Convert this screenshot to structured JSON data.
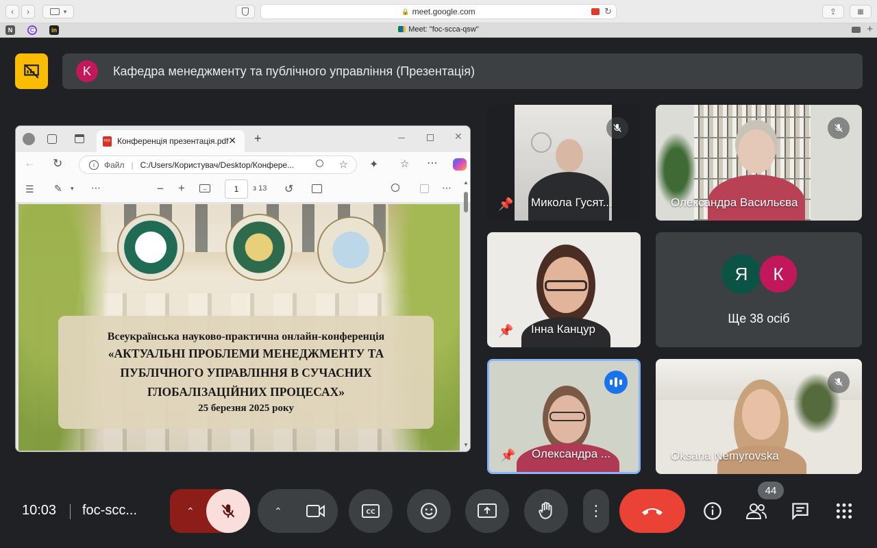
{
  "browser": {
    "url": "meet.google.com",
    "tab_title": "Meet: \"foc-scca-qsw\"",
    "favorites": [
      "N",
      "C",
      "in"
    ]
  },
  "header": {
    "avatar_letter": "K",
    "meeting_title": "Кафедра менеджменту та публічного управління (Презентація)"
  },
  "shared_screen": {
    "tab_title": "Конференція презентація.pdf",
    "address_label": "Файл",
    "address_path": "C:/Users/Користувач/Desktop/Конфере...",
    "page_current": "1",
    "page_total": "з 13",
    "slide": {
      "line1": "Всеукраїнська науково-практична онлайн-конференція",
      "line2": "«АКТУАЛЬНІ ПРОБЛЕМИ МЕНЕДЖМЕНТУ ТА",
      "line3": "ПУБЛІЧНОГО УПРАВЛІННЯ В СУЧАСНИХ",
      "line4": "ГЛОБАЛІЗАЦІЙНИХ ПРОЦЕСАХ»",
      "date": "25 березня 2025 року"
    }
  },
  "participants": [
    {
      "name": "Микола Гусят...",
      "muted": true,
      "pinned": true
    },
    {
      "name": "Олександра Васильєва",
      "muted": true,
      "pinned": false
    },
    {
      "name": "Інна Канцур",
      "muted": false,
      "pinned": true
    },
    {
      "name": "Олександра ...",
      "muted": false,
      "pinned": true,
      "speaking": true
    },
    {
      "name": "Oksana Nemyrovska",
      "muted": true,
      "pinned": false
    }
  ],
  "others": {
    "avatars": [
      "Я",
      "К"
    ],
    "avatar_colors": [
      "#0b5345",
      "#c2185b"
    ],
    "label": "Ще 38 осіб"
  },
  "bottom_bar": {
    "time": "10:03",
    "meeting_code": "foc-scc...",
    "people_count": "44",
    "end_call_color": "#ea4335"
  }
}
